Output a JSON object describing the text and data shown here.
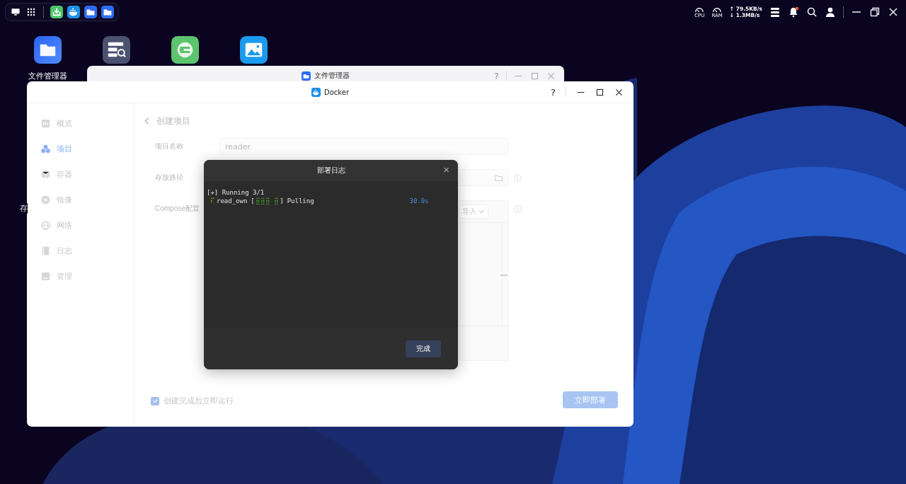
{
  "top_bar": {
    "status": {
      "cpu_label": "CPU",
      "ram_label": "RAM",
      "upload": "↑ 79.5KB/s",
      "download": "↓ 1.3MB/s",
      "notification_dot": true
    }
  },
  "desktop": {
    "icons": [
      {
        "kind": "files",
        "label": "文件管理器"
      },
      {
        "kind": "search"
      },
      {
        "kind": "network"
      },
      {
        "kind": "photos"
      }
    ],
    "partial_label": "存"
  },
  "file_manager_window": {
    "title": "文件管理器",
    "help": "?"
  },
  "docker_window": {
    "title": "Docker",
    "help": "?",
    "sidebar": {
      "items": [
        {
          "kind": "chart",
          "label": "概览",
          "selected": false
        },
        {
          "kind": "project",
          "label": "项目",
          "selected": true
        },
        {
          "kind": "container",
          "label": "容器",
          "selected": false
        },
        {
          "kind": "image",
          "label": "镜像",
          "selected": false
        },
        {
          "kind": "network",
          "label": "网络",
          "selected": false
        },
        {
          "kind": "log",
          "label": "日志",
          "selected": false
        },
        {
          "kind": "manage",
          "label": "管理",
          "selected": false
        }
      ]
    },
    "page_title": "创建项目",
    "form": {
      "rows": [
        {
          "kind": "text",
          "label": "项目名称",
          "value": "reader"
        },
        {
          "kind": "path",
          "label": "存放路径",
          "value": ""
        },
        {
          "kind": "compose",
          "label": "Compose配置",
          "import_button": "导入"
        }
      ]
    },
    "run_after_create": {
      "label": "创建完成后立即运行",
      "checked": true
    },
    "deploy_button": "立即部署"
  },
  "dialog": {
    "title": "部署日志",
    "close": "×",
    "log": [
      {
        "kind": "header",
        "text": "[+] Running 3/1"
      },
      {
        "kind": "progress",
        "spinner": "⠏",
        "name": "read_own",
        "bar_open": "[",
        "bar": "⣿⣿⣿ ⣿",
        "bar_close": "]",
        "status": "Pulling",
        "time": "30.0s"
      }
    ],
    "done_button": "完成"
  }
}
